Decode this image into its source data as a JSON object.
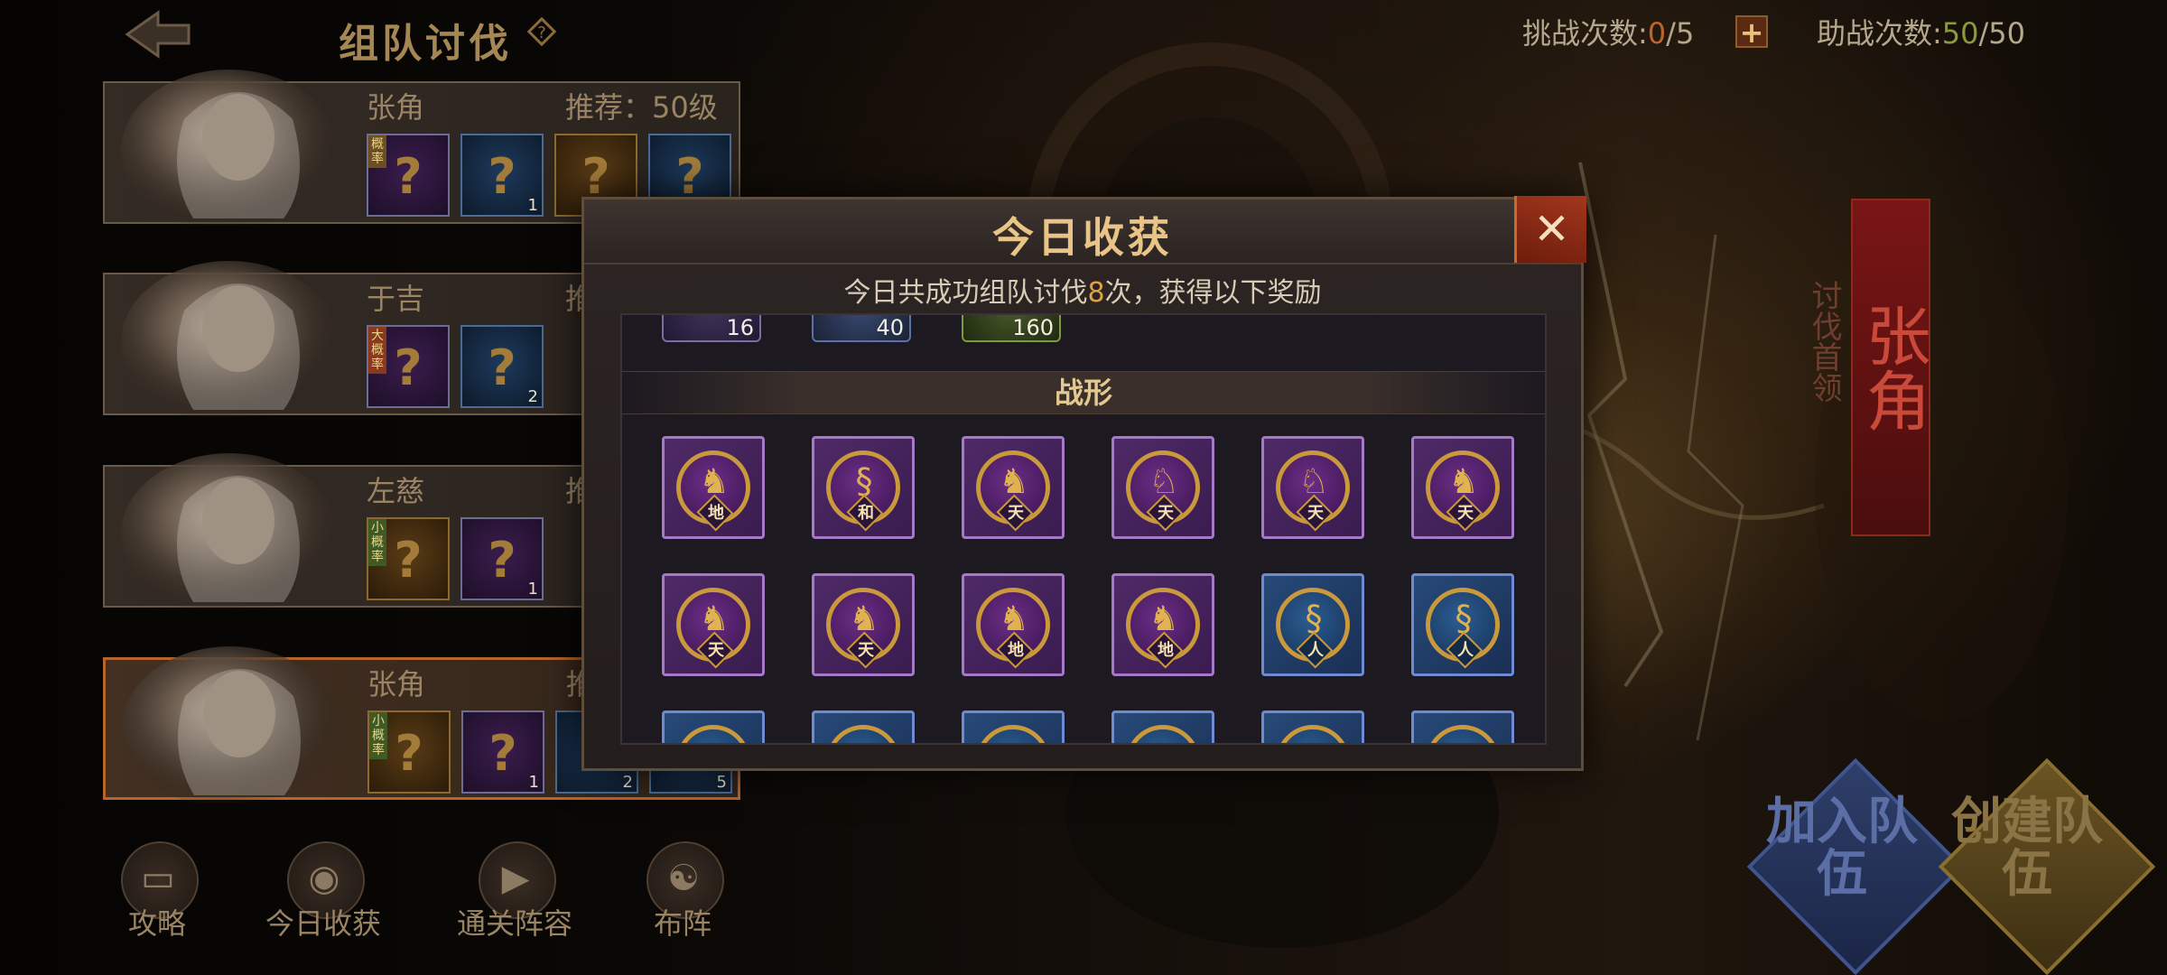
{
  "header": {
    "title": "组队讨伐",
    "help": "?",
    "challenge_label": "挑战次数:",
    "challenge_current": "0",
    "challenge_total": "/5",
    "plus": "+",
    "assist_label": "助战次数:",
    "assist_current": "50",
    "assist_total": "/50"
  },
  "bosses": [
    {
      "name": "张角",
      "recommend": "推荐：50级",
      "tag": "概率",
      "loot": [
        {
          "kind": "purple",
          "count": ""
        },
        {
          "kind": "blue",
          "count": "1"
        },
        {
          "kind": "gold",
          "count": ""
        },
        {
          "kind": "blue",
          "count": ""
        }
      ]
    },
    {
      "name": "于吉",
      "recommend": "推",
      "tag": "大概率",
      "loot": [
        {
          "kind": "purple",
          "count": ""
        },
        {
          "kind": "blue",
          "count": "2"
        }
      ]
    },
    {
      "name": "左慈",
      "recommend": "推",
      "tag": "小概率",
      "loot": [
        {
          "kind": "gold",
          "count": ""
        },
        {
          "kind": "purple",
          "count": "1"
        }
      ]
    },
    {
      "name": "张角",
      "recommend": "推",
      "tag": "小概率",
      "loot": [
        {
          "kind": "gold",
          "count": ""
        },
        {
          "kind": "purple",
          "count": "1"
        },
        {
          "kind": "blue",
          "count": "2"
        },
        {
          "kind": "blue",
          "count": "5"
        }
      ]
    }
  ],
  "bottom_nav": [
    {
      "label": "攻略",
      "icon": "book-icon"
    },
    {
      "label": "今日收获",
      "icon": "camera-icon"
    },
    {
      "label": "通关阵容",
      "icon": "video-icon"
    },
    {
      "label": "布阵",
      "icon": "taiji-icon"
    }
  ],
  "right": {
    "banner_name": "张角",
    "banner_sub": "讨伐首领",
    "join_label": "加入队伍",
    "create_label": "创建队伍"
  },
  "modal": {
    "title": "今日收获",
    "close": "✕",
    "subtitle_pre": "今日共成功组队讨伐",
    "subtitle_count": "8",
    "subtitle_post": "次，获得以下奖励",
    "prev_items": [
      {
        "count": "16",
        "kind": "purple"
      },
      {
        "count": "40",
        "kind": "blue"
      },
      {
        "count": "160",
        "kind": "green"
      }
    ],
    "section_title": "战形",
    "formations_row1": [
      {
        "mark": "地",
        "kind": "purple",
        "beast": "wolf-icon"
      },
      {
        "mark": "和",
        "kind": "purple",
        "beast": "dragon-icon"
      },
      {
        "mark": "天",
        "kind": "purple",
        "beast": "wolf-icon"
      },
      {
        "mark": "天",
        "kind": "purple",
        "beast": "horse-icon"
      },
      {
        "mark": "天",
        "kind": "purple",
        "beast": "horse-icon"
      },
      {
        "mark": "天",
        "kind": "purple",
        "beast": "tiger-icon"
      }
    ],
    "formations_row2": [
      {
        "mark": "天",
        "kind": "purple",
        "beast": "wolf-icon"
      },
      {
        "mark": "天",
        "kind": "purple",
        "beast": "tiger-icon"
      },
      {
        "mark": "地",
        "kind": "purple",
        "beast": "wolf-icon"
      },
      {
        "mark": "地",
        "kind": "purple",
        "beast": "wolf-icon"
      },
      {
        "mark": "人",
        "kind": "blue",
        "beast": "dragon-icon"
      },
      {
        "mark": "人",
        "kind": "blue",
        "beast": "dragon-icon"
      }
    ]
  }
}
